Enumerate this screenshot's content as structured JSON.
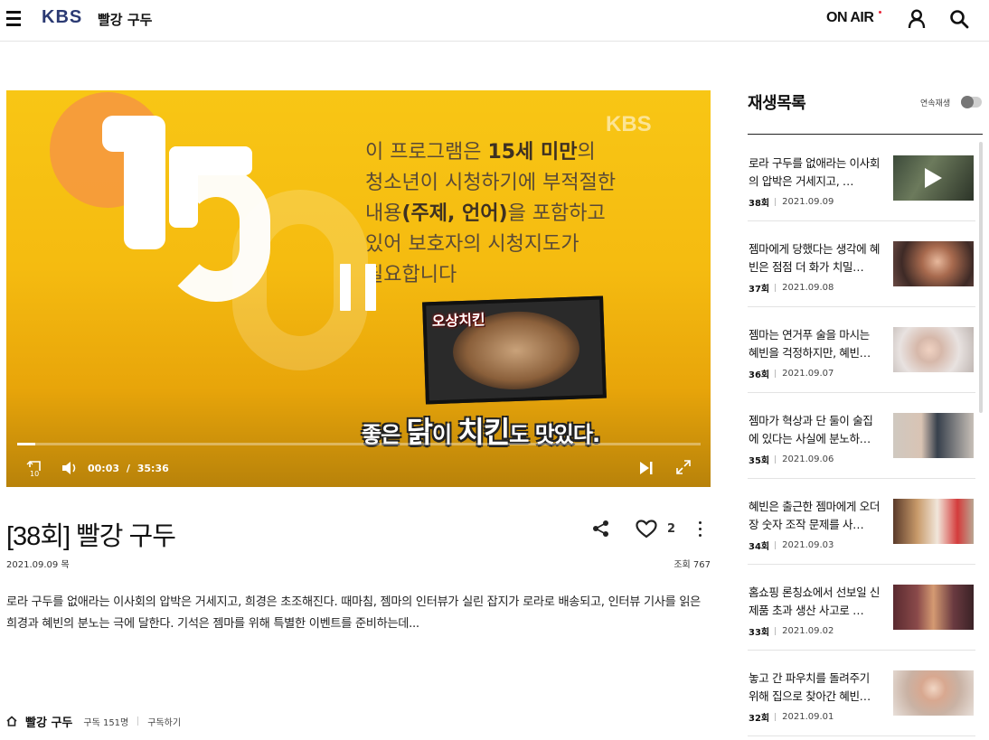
{
  "header": {
    "logo": "KBS",
    "program_title": "빨강 구두",
    "onair_label": "ON AIR"
  },
  "player": {
    "watermark": "KBS",
    "rating_number": "15",
    "notice_line1_pre": "이 프로그램은 ",
    "notice_line1_bold": "15세 미만",
    "notice_line1_post": "의",
    "notice_line2": "청소년이 시청하기에 부적절한",
    "notice_line3_pre": "내용",
    "notice_line3_bold": "(주제, 언어)",
    "notice_line3_post": "을 포함하고",
    "notice_line4": "있어 보호자의 시청지도가",
    "notice_line5": "필요합니다",
    "food_label": "오상치킨",
    "subtitle_a": "좋은 ",
    "subtitle_b": "닭",
    "subtitle_c": "이 ",
    "subtitle_d": "치킨",
    "subtitle_e": "도 맛있다.",
    "current_time": "00:03",
    "time_separator": "/",
    "duration": "35:36",
    "progress_fraction": 0.026,
    "rewind_seconds": "10"
  },
  "episode": {
    "title": "[38회] 빨강 구두",
    "date": "2021.09.09 목",
    "views": "조회 767",
    "likes": "2",
    "description": "로라 구두를 없애라는 이사회의 압박은 거세지고, 희경은 초조해진다. 때마침, 젬마의 인터뷰가 실린 잡지가 로라로 배송되고, 인터뷰 기사를 읽은 희경과 혜빈의 분노는 극에 달한다. 기석은 젬마를 위해 특별한 이벤트를 준비하는데..."
  },
  "channel": {
    "name": "빨강 구두",
    "subscribers": "구독 151명",
    "subscribe_label": "구독하기"
  },
  "sidebar": {
    "title": "재생목록",
    "autoplay_label": "연속재생",
    "items": [
      {
        "title": "로라 구두를 없애라는 이사회의 압박은 거세지고, …",
        "episode": "38회",
        "date": "2021.09.09",
        "playing": true
      },
      {
        "title": "젬마에게 당했다는 생각에 혜빈은 점점 더 화가 치밀…",
        "episode": "37회",
        "date": "2021.09.08",
        "playing": false
      },
      {
        "title": "젬마는 연거푸 술을 마시는 혜빈을 걱정하지만, 혜빈…",
        "episode": "36회",
        "date": "2021.09.07",
        "playing": false
      },
      {
        "title": "젬마가 혁상과 단 둘이 술집에 있다는 사실에 분노하…",
        "episode": "35회",
        "date": "2021.09.06",
        "playing": false
      },
      {
        "title": "혜빈은 출근한 젬마에게 오더장 숫자 조작 문제를 사…",
        "episode": "34회",
        "date": "2021.09.03",
        "playing": false
      },
      {
        "title": "홈쇼핑 론칭쇼에서 선보일 신제품 초과 생산 사고로 …",
        "episode": "33회",
        "date": "2021.09.02",
        "playing": false
      },
      {
        "title": "놓고 간 파우치를 돌려주기 위해 집으로 찾아간 혜빈…",
        "episode": "32회",
        "date": "2021.09.01",
        "playing": false
      }
    ]
  },
  "colors": {
    "brand": "#2b3a73",
    "onair_dot": "#e9263a",
    "player_bg": "#f5bb10"
  }
}
